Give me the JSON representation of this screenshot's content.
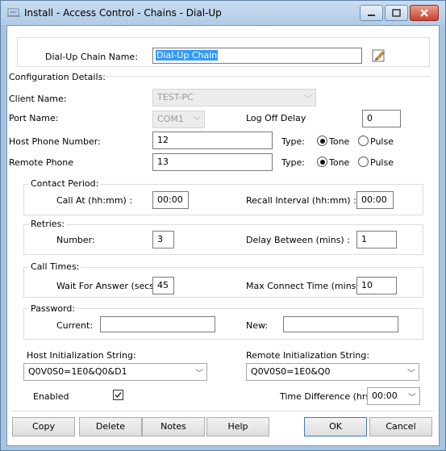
{
  "window": {
    "title": "Install - Access Control - Chains - Dial-Up",
    "colors": {
      "titlebar": "#b9d1ea",
      "close": "#c7422d",
      "selection": "#3399ff"
    }
  },
  "chain_name": {
    "label": "Dial-Up Chain Name:",
    "value": "Dial-Up Chain"
  },
  "config": {
    "title": "Configuration Details:",
    "client_name": {
      "label": "Client Name:",
      "value": "TEST-PC"
    },
    "port_name": {
      "label": "Port Name:",
      "value": "COM1"
    },
    "log_off_delay": {
      "label": "Log Off Delay",
      "value": "0"
    },
    "host_phone": {
      "label": "Host Phone Number:",
      "value": "12",
      "type_label": "Type:",
      "tone": "Tone",
      "pulse": "Pulse",
      "selected": "Tone"
    },
    "remote_phone": {
      "label": "Remote Phone",
      "value": "13",
      "type_label": "Type:",
      "tone": "Tone",
      "pulse": "Pulse",
      "selected": "Tone"
    }
  },
  "contact_period": {
    "title": "Contact Period:",
    "call_at": {
      "label": "Call At (hh:mm) :",
      "value": "00:00"
    },
    "recall_interval": {
      "label": "Recall Interval (hh:mm) :",
      "value": "00:00"
    }
  },
  "retries": {
    "title": "Retries:",
    "number": {
      "label": "Number:",
      "value": "3"
    },
    "delay_between": {
      "label": "Delay Between (mins) :",
      "value": "1"
    }
  },
  "call_times": {
    "title": "Call Times:",
    "wait_for_answer": {
      "label": "Wait For Answer (secs)",
      "value": "45"
    },
    "max_connect": {
      "label": "Max Connect Time (mins) :",
      "value": "10"
    }
  },
  "password": {
    "title": "Password:",
    "current": {
      "label": "Current:",
      "value": ""
    },
    "new": {
      "label": "New:",
      "value": ""
    }
  },
  "init": {
    "host": {
      "label": "Host Initialization String:",
      "value": "Q0V0S0=1E0&Q0&D1"
    },
    "remote": {
      "label": "Remote Initialization String:",
      "value": "Q0V0S0=1E0&Q0"
    }
  },
  "enabled": {
    "label": "Enabled",
    "checked": true
  },
  "time_difference": {
    "label": "Time Difference (hrs)",
    "value": "00:00"
  },
  "buttons": {
    "copy": "Copy",
    "delete": "Delete",
    "notes": "Notes",
    "help": "Help",
    "ok": "OK",
    "cancel": "Cancel"
  },
  "icons": {
    "app": "install-icon",
    "edit": "edit-icon",
    "minimize": "minimize-icon",
    "maximize": "maximize-icon",
    "close": "close-icon",
    "checkmark": "checkmark-icon",
    "dropdown": "chevron-down-icon"
  }
}
